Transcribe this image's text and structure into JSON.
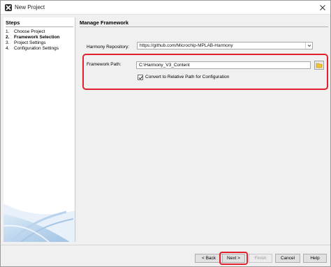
{
  "window": {
    "title": "New Project",
    "close_icon": "close-icon",
    "app_icon": "netbeans-icon"
  },
  "steps": {
    "title": "Steps",
    "items": [
      {
        "num": "1.",
        "label": "Choose Project",
        "active": false
      },
      {
        "num": "2.",
        "label": "Framework Selection",
        "active": true
      },
      {
        "num": "3.",
        "label": "Project Settings",
        "active": false
      },
      {
        "num": "4.",
        "label": "Configuration Settings",
        "active": false
      }
    ]
  },
  "main": {
    "title": "Manage Framework",
    "repository": {
      "label": "Harmony Repository:",
      "value": "https://github.com/Microchip-MPLAB-Harmony"
    },
    "framework_path": {
      "label": "Framework Path:",
      "value": "C:\\Harmony_V3_Content",
      "browse_icon": "folder-icon"
    },
    "convert": {
      "label": "Convert to Relative Path for Configuration",
      "checked": true
    }
  },
  "footer": {
    "back": "< Back",
    "next": "Next >",
    "finish": "Finish",
    "cancel": "Cancel",
    "help": "Help"
  },
  "colors": {
    "highlight": "#e0202a",
    "panel": "#f0f0f0"
  }
}
